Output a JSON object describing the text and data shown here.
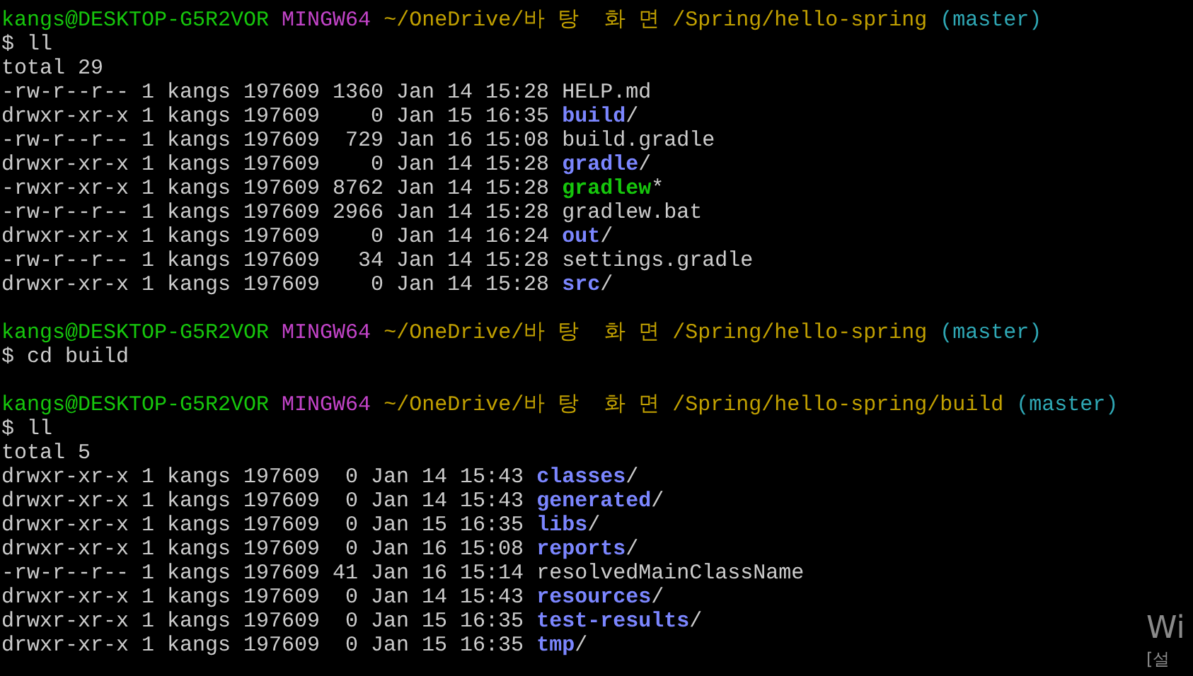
{
  "terminal": {
    "lines": [
      {
        "kind": "prompt",
        "user_host": "kangs@DESKTOP-G5R2VOR",
        "shell": "MINGW64",
        "path": "~/OneDrive/바 탕  화 면 /Spring/hello-spring",
        "branch": "(master)"
      },
      {
        "kind": "command",
        "text": "$ ll"
      },
      {
        "kind": "text",
        "text": "total 29"
      },
      {
        "kind": "file",
        "meta": "-rw-r--r-- 1 kangs 197609 1360 Jan 14 15:28",
        "name": "HELP.md"
      },
      {
        "kind": "dir",
        "meta": "drwxr-xr-x 1 kangs 197609    0 Jan 15 16:35",
        "name": "build",
        "suffix": "/"
      },
      {
        "kind": "file",
        "meta": "-rw-r--r-- 1 kangs 197609  729 Jan 16 15:08",
        "name": "build.gradle"
      },
      {
        "kind": "dir",
        "meta": "drwxr-xr-x 1 kangs 197609    0 Jan 14 15:28",
        "name": "gradle",
        "suffix": "/"
      },
      {
        "kind": "exec",
        "meta": "-rwxr-xr-x 1 kangs 197609 8762 Jan 14 15:28",
        "name": "gradlew",
        "suffix": "*"
      },
      {
        "kind": "file",
        "meta": "-rw-r--r-- 1 kangs 197609 2966 Jan 14 15:28",
        "name": "gradlew.bat"
      },
      {
        "kind": "dir",
        "meta": "drwxr-xr-x 1 kangs 197609    0 Jan 14 16:24",
        "name": "out",
        "suffix": "/"
      },
      {
        "kind": "file",
        "meta": "-rw-r--r-- 1 kangs 197609   34 Jan 14 15:28",
        "name": "settings.gradle"
      },
      {
        "kind": "dir",
        "meta": "drwxr-xr-x 1 kangs 197609    0 Jan 14 15:28",
        "name": "src",
        "suffix": "/"
      },
      {
        "kind": "blank"
      },
      {
        "kind": "prompt",
        "user_host": "kangs@DESKTOP-G5R2VOR",
        "shell": "MINGW64",
        "path": "~/OneDrive/바 탕  화 면 /Spring/hello-spring",
        "branch": "(master)"
      },
      {
        "kind": "command",
        "text": "$ cd build"
      },
      {
        "kind": "blank"
      },
      {
        "kind": "prompt",
        "user_host": "kangs@DESKTOP-G5R2VOR",
        "shell": "MINGW64",
        "path": "~/OneDrive/바 탕  화 면 /Spring/hello-spring/build",
        "branch": "(master)"
      },
      {
        "kind": "command",
        "text": "$ ll"
      },
      {
        "kind": "text",
        "text": "total 5"
      },
      {
        "kind": "dir",
        "meta": "drwxr-xr-x 1 kangs 197609  0 Jan 14 15:43",
        "name": "classes",
        "suffix": "/"
      },
      {
        "kind": "dir",
        "meta": "drwxr-xr-x 1 kangs 197609  0 Jan 14 15:43",
        "name": "generated",
        "suffix": "/"
      },
      {
        "kind": "dir",
        "meta": "drwxr-xr-x 1 kangs 197609  0 Jan 15 16:35",
        "name": "libs",
        "suffix": "/"
      },
      {
        "kind": "dir",
        "meta": "drwxr-xr-x 1 kangs 197609  0 Jan 16 15:08",
        "name": "reports",
        "suffix": "/"
      },
      {
        "kind": "file",
        "meta": "-rw-r--r-- 1 kangs 197609 41 Jan 16 15:14",
        "name": "resolvedMainClassName"
      },
      {
        "kind": "dir",
        "meta": "drwxr-xr-x 1 kangs 197609  0 Jan 14 15:43",
        "name": "resources",
        "suffix": "/"
      },
      {
        "kind": "dir",
        "meta": "drwxr-xr-x 1 kangs 197609  0 Jan 15 16:35",
        "name": "test-results",
        "suffix": "/"
      },
      {
        "kind": "dir",
        "meta": "drwxr-xr-x 1 kangs 197609  0 Jan 15 16:35",
        "name": "tmp",
        "suffix": "/"
      }
    ]
  },
  "activation_notice": {
    "title": "Wi",
    "subtitle": "[설"
  }
}
